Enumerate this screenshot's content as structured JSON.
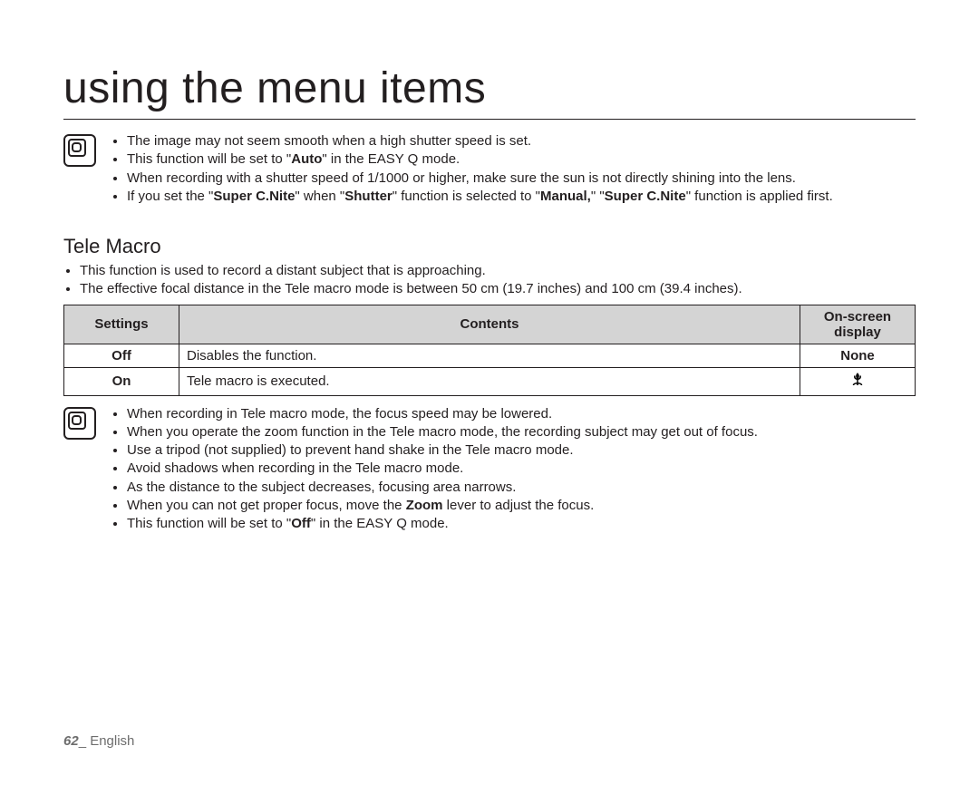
{
  "title": "using the menu items",
  "note1": {
    "b1": "The image may not seem smooth when a high shutter speed is set.",
    "b2_pre": "This function will be set to \"",
    "b2_bold": "Auto",
    "b2_post": "\" in the EASY Q mode.",
    "b3": "When recording with a shutter speed of 1/1000 or higher, make sure the sun is not directly shining into the lens.",
    "b4_pre": "If you set the \"",
    "b4_b1": "Super C.Nite",
    "b4_mid1": "\" when \"",
    "b4_b2": "Shutter",
    "b4_mid2": "\" function is selected to \"",
    "b4_b3": "Manual,",
    "b4_mid3": "\" \"",
    "b4_b4": "Super C.Nite",
    "b4_post": "\" function is applied first."
  },
  "section_heading": "Tele Macro",
  "intro": {
    "b1": "This function is used to record a distant subject that is approaching.",
    "b2": "The effective focal distance in the Tele macro mode is between 50 cm (19.7 inches) and 100 cm (39.4 inches)."
  },
  "table": {
    "h1": "Settings",
    "h2": "Contents",
    "h3": "On-screen display",
    "r1c1": "Off",
    "r1c2": "Disables the function.",
    "r1c3": "None",
    "r2c1": "On",
    "r2c2": "Tele macro is executed.",
    "r2c3_icon": "tele-macro-icon"
  },
  "note2": {
    "b1": "When recording in Tele macro mode, the focus speed may be lowered.",
    "b2": "When you operate the zoom function in the Tele macro mode, the recording subject may get out of focus.",
    "b3": "Use a tripod (not supplied) to prevent hand shake in the Tele macro mode.",
    "b4": "Avoid shadows when recording in the Tele macro mode.",
    "b5": "As the distance to the subject decreases, focusing area narrows.",
    "b6_pre": "When you can not get proper focus, move the ",
    "b6_bold": "Zoom",
    "b6_post": " lever to adjust the focus.",
    "b7_pre": "This function will be set to \"",
    "b7_bold": "Off",
    "b7_post": "\" in the EASY Q mode."
  },
  "footer": {
    "page": "62",
    "sep": "_ ",
    "lang": "English"
  }
}
